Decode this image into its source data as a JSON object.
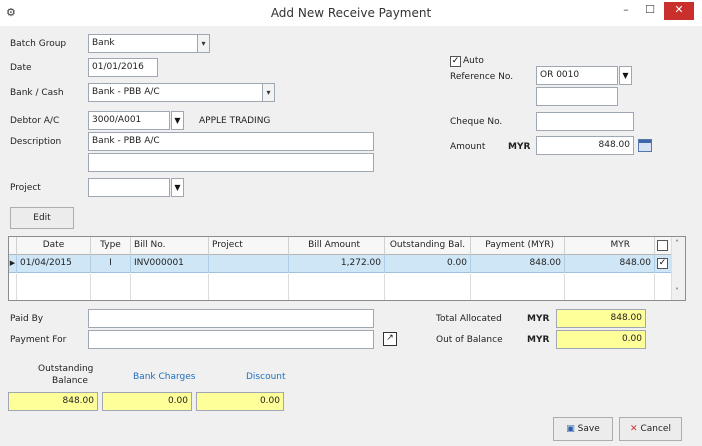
{
  "window": {
    "title": "Add New Receive Payment",
    "app_icon": "gear-icon",
    "minimize": "–",
    "maximize": "☐",
    "close": "✕"
  },
  "form": {
    "batch_group": {
      "label": "Batch Group",
      "value": "Bank"
    },
    "date": {
      "label": "Date",
      "value": "01/01/2016"
    },
    "bank_cash": {
      "label": "Bank / Cash",
      "value": "Bank - PBB A/C"
    },
    "debtor": {
      "label": "Debtor A/C",
      "value": "3000/A001",
      "name": "APPLE TRADING"
    },
    "description": {
      "label": "Description",
      "line1": "Bank - PBB A/C",
      "line2": ""
    },
    "project": {
      "label": "Project",
      "value": ""
    },
    "auto": {
      "label": "Auto",
      "checked": true
    },
    "reference": {
      "label": "Reference No.",
      "value": "OR 0010",
      "extra": ""
    },
    "cheque": {
      "label": "Cheque No.",
      "value": ""
    },
    "amount": {
      "label": "Amount",
      "currency": "MYR",
      "value": "848.00"
    }
  },
  "edit_button": "Edit",
  "grid": {
    "headers": [
      "Date",
      "Type",
      "Bill No.",
      "Project",
      "Bill Amount",
      "Outstanding Bal.",
      "Payment (MYR)",
      "MYR"
    ],
    "rows": [
      {
        "date": "01/04/2015",
        "type": "I",
        "bill_no": "INV000001",
        "project": "",
        "bill_amount": "1,272.00",
        "outstanding": "0.00",
        "payment": "848.00",
        "myr": "848.00",
        "checked": true
      }
    ]
  },
  "bottom": {
    "paid_by": {
      "label": "Paid By",
      "value": ""
    },
    "payment_for": {
      "label": "Payment For",
      "value": ""
    },
    "total_allocated": {
      "label": "Total Allocated",
      "currency": "MYR",
      "value": "848.00"
    },
    "out_of_balance": {
      "label": "Out of Balance",
      "currency": "MYR",
      "value": "0.00"
    },
    "outstanding_balance": {
      "label_line1": "Outstanding",
      "label_line2": "Balance",
      "value": "848.00"
    },
    "bank_charges": {
      "label": "Bank Charges",
      "value": "0.00"
    },
    "discount": {
      "label": "Discount",
      "value": "0.00"
    }
  },
  "buttons": {
    "save": "Save",
    "cancel": "Cancel"
  },
  "colors": {
    "highlight_row": "#cfe6f7",
    "yellow_field": "#ffff99",
    "link_blue": "#1f6fbf",
    "close_red": "#c9302c"
  }
}
